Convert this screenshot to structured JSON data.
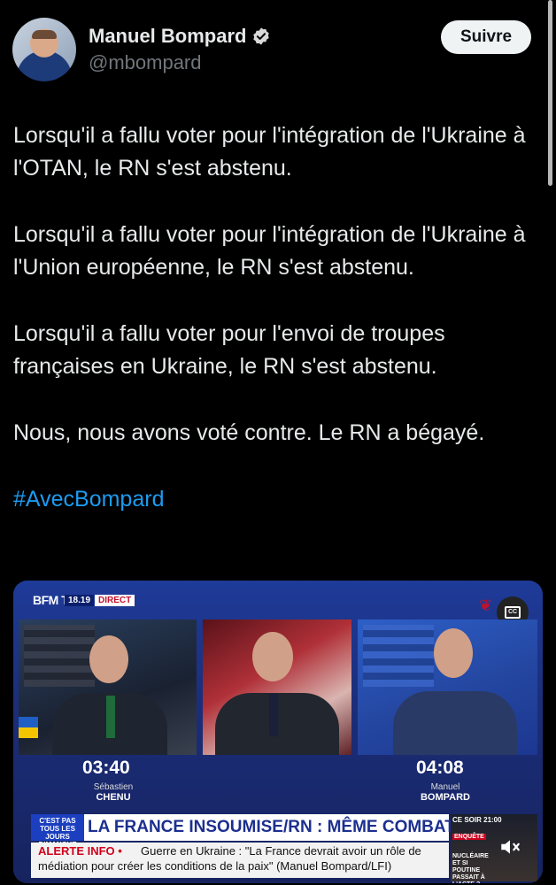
{
  "author": {
    "name": "Manuel Bompard",
    "handle": "@mbompard",
    "verified": true,
    "follow_label": "Suivre"
  },
  "tweet": {
    "paragraphs": [
      "Lorsqu'il a fallu voter pour l'intégration de l'Ukraine à l'OTAN, le RN s'est abstenu.",
      "Lorsqu'il a fallu voter pour l'intégration de l'Ukraine à l'Union européenne, le RN s'est abstenu.",
      "Lorsqu'il a fallu voter pour l'envoi de troupes françaises en Ukraine, le RN s'est abstenu.",
      "Nous, nous avons voté contre. Le RN a bégayé."
    ],
    "hashtag": "#AvecBompard"
  },
  "video": {
    "channel": "BFM TV.",
    "time": "18.19",
    "live_label": "DIRECT",
    "left_timer": "03:40",
    "left_guest_first": "Sébastien",
    "left_guest_last": "CHENU",
    "right_timer": "04:08",
    "right_guest_first": "Manuel",
    "right_guest_last": "BOMPARD",
    "show_name": "C'EST PAS TOUS LES JOURS DIMANCHE",
    "headline": "LA FRANCE INSOUMISE/RN : MÊME COMBAT ?",
    "alert_label": "ALERTE INFO •",
    "ticker_line1": "Guerre en Ukraine : \"La France devrait avoir un rôle de",
    "ticker_line2": "médiation pour créer les conditions de la paix\" (Manuel Bompard/LFI)",
    "promo_top": "CE SOIR 21:00",
    "promo_tag": "ENQUÊTE",
    "promo_sub": "NUCLÉAIRE ET SI POUTINE PASSAIT À L'ACTE ?",
    "colors": {
      "accent_blue": "#1d9bf0",
      "bfm_red": "#d0001c",
      "bfm_blue": "#1c3fbf"
    }
  }
}
